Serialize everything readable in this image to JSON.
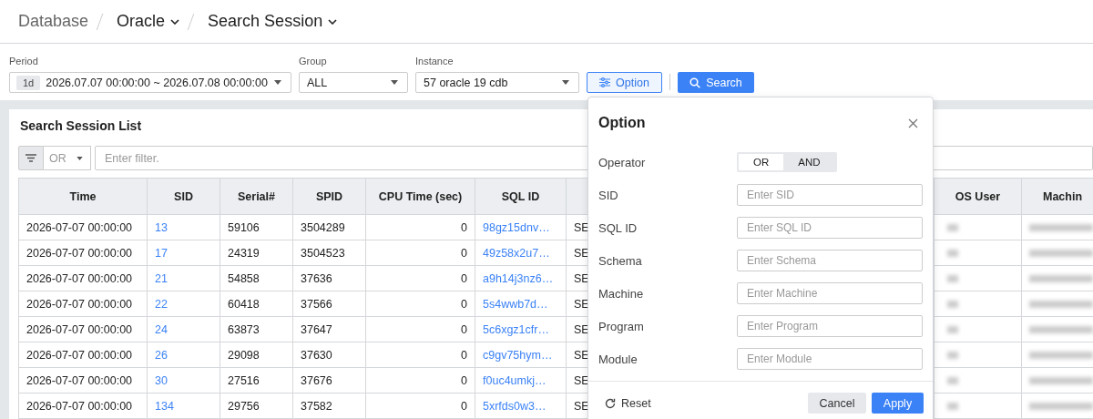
{
  "breadcrumb": [
    {
      "label": "Database",
      "dropdown": false,
      "current": false
    },
    {
      "label": "Oracle",
      "dropdown": true,
      "current": true
    },
    {
      "label": "Search Session",
      "dropdown": true,
      "current": true
    }
  ],
  "filters": {
    "period": {
      "label": "Period",
      "badge": "1d",
      "value": "2026.07.07 00:00:00 ~ 2026.07.08 00:00:00"
    },
    "group": {
      "label": "Group",
      "value": "ALL"
    },
    "instance": {
      "label": "Instance",
      "value": "57 oracle 19 cdb"
    },
    "option_button": "Option",
    "search_button": "Search"
  },
  "session_list": {
    "title": "Search Session List",
    "filter": {
      "operator": "OR",
      "placeholder": "Enter filter."
    },
    "columns": [
      {
        "label": "Time",
        "kind": "text"
      },
      {
        "label": "SID",
        "kind": "link"
      },
      {
        "label": "Serial#",
        "kind": "text"
      },
      {
        "label": "SPID",
        "kind": "text"
      },
      {
        "label": "CPU Time (sec)",
        "kind": "number"
      },
      {
        "label": "SQL ID",
        "kind": "link"
      },
      {
        "kind": "text"
      },
      {
        "label": "OS User",
        "kind": "blurred"
      },
      {
        "label": "Machin",
        "kind": "blurred"
      }
    ],
    "rows": [
      {
        "cells": [
          "2026-07-07 00:00:00",
          "13",
          "59106",
          "3504289",
          "0",
          "98gz15dnv…",
          "SE"
        ]
      },
      {
        "cells": [
          "2026-07-07 00:00:00",
          "17",
          "24319",
          "3504523",
          "0",
          "49z58x2u7…",
          "SE"
        ]
      },
      {
        "cells": [
          "2026-07-07 00:00:00",
          "21",
          "54858",
          "37636",
          "0",
          "a9h14j3nz6…",
          "SE"
        ]
      },
      {
        "cells": [
          "2026-07-07 00:00:00",
          "22",
          "60418",
          "37566",
          "0",
          "5s4wwb7d…",
          "SE"
        ]
      },
      {
        "cells": [
          "2026-07-07 00:00:00",
          "24",
          "63873",
          "37647",
          "0",
          "5c6xgz1cfr…",
          "SE"
        ]
      },
      {
        "cells": [
          "2026-07-07 00:00:00",
          "26",
          "29098",
          "37630",
          "0",
          "c9gv75hym…",
          "SE"
        ]
      },
      {
        "cells": [
          "2026-07-07 00:00:00",
          "30",
          "27516",
          "37676",
          "0",
          "f0uc4umkj…",
          "SE"
        ]
      },
      {
        "cells": [
          "2026-07-07 00:00:00",
          "134",
          "29756",
          "37582",
          "0",
          "5xrfds0w3…",
          "SE"
        ]
      }
    ]
  },
  "option_dialog": {
    "title": "Option",
    "operator": {
      "label": "Operator",
      "options": [
        {
          "label": "OR",
          "selected": true
        },
        {
          "label": "AND",
          "selected": false
        }
      ]
    },
    "fields": [
      {
        "label": "SID",
        "placeholder": "Enter SID"
      },
      {
        "label": "SQL ID",
        "placeholder": "Enter SQL ID"
      },
      {
        "label": "Schema",
        "placeholder": "Enter Schema"
      },
      {
        "label": "Machine",
        "placeholder": "Enter Machine"
      },
      {
        "label": "Program",
        "placeholder": "Enter Program"
      },
      {
        "label": "Module",
        "placeholder": "Enter Module"
      }
    ],
    "reset": "Reset",
    "cancel": "Cancel",
    "apply": "Apply"
  }
}
